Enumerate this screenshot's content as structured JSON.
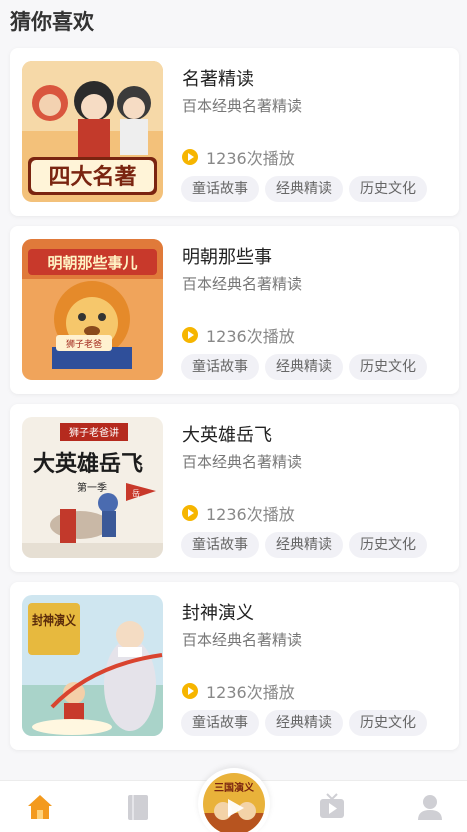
{
  "section": {
    "title": "猜你喜欢"
  },
  "books": [
    {
      "title": "名著精读",
      "subtitle": "百本经典名著精读",
      "plays": "1236次播放",
      "tags": [
        "童话故事",
        "经典精读",
        "历史文化"
      ],
      "cover_text": "四大名著"
    },
    {
      "title": "明朝那些事",
      "subtitle": "百本经典名著精读",
      "plays": "1236次播放",
      "tags": [
        "童话故事",
        "经典精读",
        "历史文化"
      ],
      "cover_text": "明朝那些事儿",
      "cover_sub": "狮子老爸"
    },
    {
      "title": "大英雄岳飞",
      "subtitle": "百本经典名著精读",
      "plays": "1236次播放",
      "tags": [
        "童话故事",
        "经典精读",
        "历史文化"
      ],
      "cover_text": "大英雄岳飞",
      "cover_top": "狮子老爸讲",
      "cover_sub": "第一季",
      "flag_text": "岳"
    },
    {
      "title": "封神演义",
      "subtitle": "百本经典名著精读",
      "plays": "1236次播放",
      "tags": [
        "童话故事",
        "经典精读",
        "历史文化"
      ],
      "cover_text": "封神演义"
    }
  ],
  "tabbar": {
    "tabs": [
      {
        "icon": "home-icon",
        "active": true
      },
      {
        "icon": "book-icon",
        "active": false
      },
      {
        "icon": "play-center-icon",
        "active": false
      },
      {
        "icon": "tv-icon",
        "active": false
      },
      {
        "icon": "user-icon",
        "active": false
      }
    ],
    "center_cover_text": "三国演义",
    "active_color": "#f39a1e",
    "inactive_color": "#cfcfd4"
  },
  "colors": {
    "accent": "#f6b500",
    "tag_bg": "#f1f1f6"
  }
}
